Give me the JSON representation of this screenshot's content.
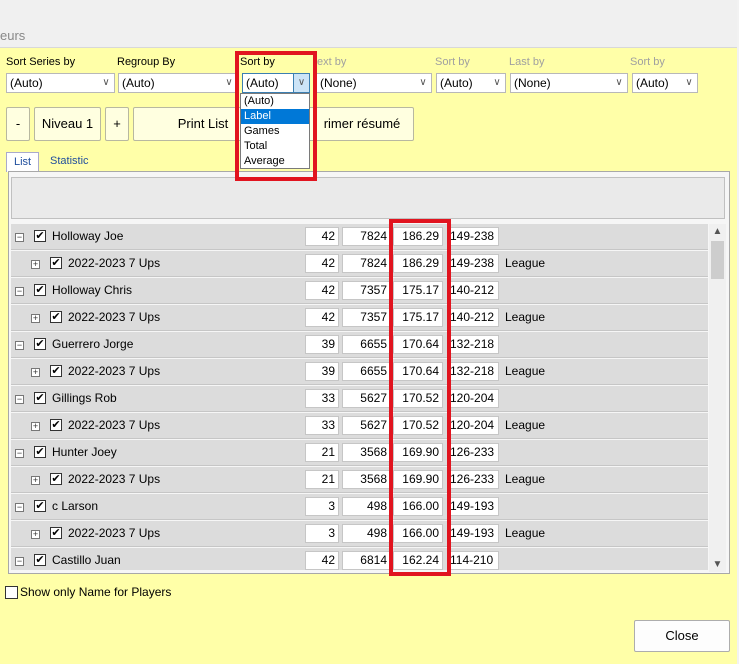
{
  "window": {
    "title_fragment": "eurs"
  },
  "sort_controls": [
    {
      "label": "Sort Series by",
      "value": "(Auto)",
      "dim": false
    },
    {
      "label": "Regroup By",
      "value": "(Auto)",
      "dim": false
    },
    {
      "label": "Sort by",
      "value": "(Auto)",
      "dim": false
    },
    {
      "label": "ext by",
      "value": "(None)",
      "dim": true
    },
    {
      "label": "Sort by",
      "value": "(Auto)",
      "dim": true
    },
    {
      "label": "Last by",
      "value": "(None)",
      "dim": true
    },
    {
      "label": "Sort by",
      "value": "(Auto)",
      "dim": true
    }
  ],
  "dropdown": {
    "options": [
      "(Auto)",
      "Label",
      "Games",
      "Total",
      "Average"
    ],
    "selected": "Label"
  },
  "toolbar": {
    "minus": "-",
    "level": "Niveau 1",
    "plus": "+",
    "print_list": "Print List",
    "print_summary": "rimer résumé"
  },
  "tabs": [
    "List",
    "Statistic"
  ],
  "rows": [
    {
      "level": 0,
      "name": "Holloway Joe",
      "games": "42",
      "total": "7824",
      "avg": "186.29",
      "range": "149-238",
      "type": ""
    },
    {
      "level": 1,
      "name": "2022-2023 7 Ups",
      "games": "42",
      "total": "7824",
      "avg": "186.29",
      "range": "149-238",
      "type": "League"
    },
    {
      "level": 0,
      "name": "Holloway Chris",
      "games": "42",
      "total": "7357",
      "avg": "175.17",
      "range": "140-212",
      "type": ""
    },
    {
      "level": 1,
      "name": "2022-2023 7 Ups",
      "games": "42",
      "total": "7357",
      "avg": "175.17",
      "range": "140-212",
      "type": "League"
    },
    {
      "level": 0,
      "name": "Guerrero Jorge",
      "games": "39",
      "total": "6655",
      "avg": "170.64",
      "range": "132-218",
      "type": ""
    },
    {
      "level": 1,
      "name": "2022-2023 7 Ups",
      "games": "39",
      "total": "6655",
      "avg": "170.64",
      "range": "132-218",
      "type": "League"
    },
    {
      "level": 0,
      "name": "Gillings Rob",
      "games": "33",
      "total": "5627",
      "avg": "170.52",
      "range": "120-204",
      "type": ""
    },
    {
      "level": 1,
      "name": "2022-2023 7 Ups",
      "games": "33",
      "total": "5627",
      "avg": "170.52",
      "range": "120-204",
      "type": "League"
    },
    {
      "level": 0,
      "name": "Hunter Joey",
      "games": "21",
      "total": "3568",
      "avg": "169.90",
      "range": "126-233",
      "type": ""
    },
    {
      "level": 1,
      "name": "2022-2023 7 Ups",
      "games": "21",
      "total": "3568",
      "avg": "169.90",
      "range": "126-233",
      "type": "League"
    },
    {
      "level": 0,
      "name": "c Larson",
      "games": "3",
      "total": "498",
      "avg": "166.00",
      "range": "149-193",
      "type": ""
    },
    {
      "level": 1,
      "name": "2022-2023 7 Ups",
      "games": "3",
      "total": "498",
      "avg": "166.00",
      "range": "149-193",
      "type": "League"
    },
    {
      "level": 0,
      "name": "Castillo Juan",
      "games": "42",
      "total": "6814",
      "avg": "162.24",
      "range": "114-210",
      "type": ""
    }
  ],
  "show_only_label": "Show only Name for Players",
  "close_label": "Close",
  "colors": {
    "background": "#ffffa8",
    "highlight": "#e1141f",
    "selection": "#0078d7"
  }
}
